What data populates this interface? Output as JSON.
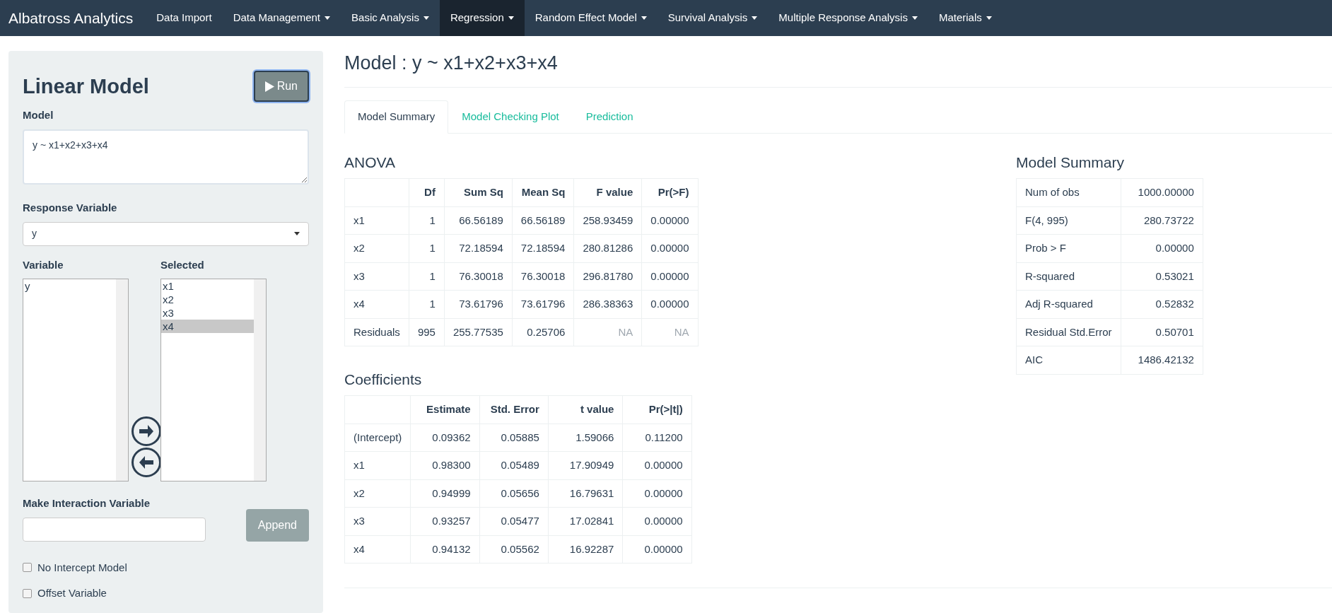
{
  "navbar": {
    "brand": "Albatross Analytics",
    "items": [
      {
        "label": "Data Import",
        "dropdown": false,
        "selected": false
      },
      {
        "label": "Data Management",
        "dropdown": true,
        "selected": false
      },
      {
        "label": "Basic Analysis",
        "dropdown": true,
        "selected": false
      },
      {
        "label": "Regression",
        "dropdown": true,
        "selected": true
      },
      {
        "label": "Random Effect Model",
        "dropdown": true,
        "selected": false
      },
      {
        "label": "Survival Analysis",
        "dropdown": true,
        "selected": false
      },
      {
        "label": "Multiple Response Analysis",
        "dropdown": true,
        "selected": false
      },
      {
        "label": "Materials",
        "dropdown": true,
        "selected": false
      }
    ]
  },
  "sidebar": {
    "title": "Linear Model",
    "run_button": "Run",
    "model": {
      "label": "Model",
      "value": "y ~ x1+x2+x3+x4"
    },
    "response": {
      "label": "Response Variable",
      "value": "y"
    },
    "variable_list": {
      "label": "Variable",
      "items": [
        {
          "text": "y",
          "selected": false
        }
      ]
    },
    "selected_list": {
      "label": "Selected",
      "items": [
        {
          "text": "x1",
          "selected": false
        },
        {
          "text": "x2",
          "selected": false
        },
        {
          "text": "x3",
          "selected": false
        },
        {
          "text": "x4",
          "selected": true
        }
      ]
    },
    "interaction": {
      "label": "Make Interaction Variable",
      "button": "Append"
    },
    "checkboxes": [
      {
        "label": "No Intercept Model",
        "checked": false
      },
      {
        "label": "Offset Variable",
        "checked": false
      }
    ]
  },
  "main": {
    "title": "Model : y ~ x1+x2+x3+x4",
    "tabs": [
      {
        "label": "Model Summary",
        "selected": true
      },
      {
        "label": "Model Checking Plot",
        "selected": false
      },
      {
        "label": "Prediction",
        "selected": false
      }
    ],
    "anova": {
      "title": "ANOVA",
      "columns": [
        "",
        "Df",
        "Sum Sq",
        "Mean Sq",
        "F value",
        "Pr(>F)"
      ],
      "rows": [
        [
          "x1",
          "1",
          "66.56189",
          "66.56189",
          "258.93459",
          "0.00000"
        ],
        [
          "x2",
          "1",
          "72.18594",
          "72.18594",
          "280.81286",
          "0.00000"
        ],
        [
          "x3",
          "1",
          "76.30018",
          "76.30018",
          "296.81780",
          "0.00000"
        ],
        [
          "x4",
          "1",
          "73.61796",
          "73.61796",
          "286.38363",
          "0.00000"
        ],
        [
          "Residuals",
          "995",
          "255.77535",
          "0.25706",
          {
            "text": "NA",
            "missing": true
          },
          {
            "text": "NA",
            "missing": true
          }
        ]
      ]
    },
    "coefficients": {
      "title": "Coefficients",
      "columns": [
        "",
        "Estimate",
        "Std. Error",
        "t value",
        "Pr(>|t|)"
      ],
      "rows": [
        [
          "(Intercept)",
          "0.09362",
          "0.05885",
          "1.59066",
          "0.11200"
        ],
        [
          "x1",
          "0.98300",
          "0.05489",
          "17.90949",
          "0.00000"
        ],
        [
          "x2",
          "0.94999",
          "0.05656",
          "16.79631",
          "0.00000"
        ],
        [
          "x3",
          "0.93257",
          "0.05477",
          "17.02841",
          "0.00000"
        ],
        [
          "x4",
          "0.94132",
          "0.05562",
          "16.92287",
          "0.00000"
        ]
      ]
    },
    "model_summary": {
      "title": "Model Summary",
      "rows": [
        [
          "Num of obs",
          "1000.00000"
        ],
        [
          "F(4, 995)",
          "280.73722"
        ],
        [
          "Prob > F",
          "0.00000"
        ],
        [
          "R-squared",
          "0.53021"
        ],
        [
          "Adj R-squared",
          "0.52832"
        ],
        [
          "Residual Std.Error",
          "0.50701"
        ],
        [
          "AIC",
          "1486.42132"
        ]
      ]
    }
  }
}
